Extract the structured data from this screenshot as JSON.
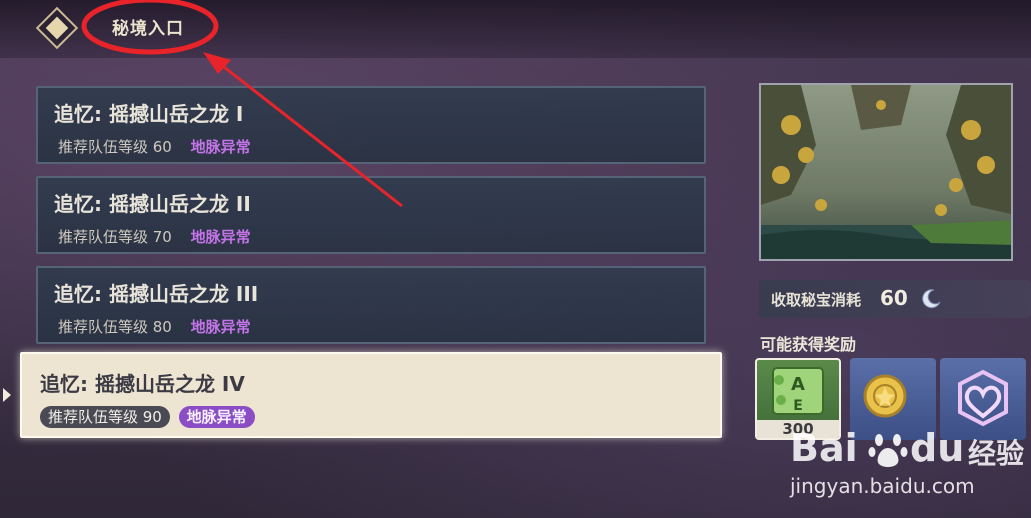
{
  "header": {
    "title": "秘境入口",
    "logo_icon": "diamond-icon"
  },
  "domains": [
    {
      "name": "追忆: 摇撼山岳之龙 I",
      "level": "推荐队伍等级 60",
      "tag": "地脉异常"
    },
    {
      "name": "追忆: 摇撼山岳之龙 II",
      "level": "推荐队伍等级 70",
      "tag": "地脉异常"
    },
    {
      "name": "追忆: 摇撼山岳之龙 III",
      "level": "推荐队伍等级 80",
      "tag": "地脉异常"
    },
    {
      "name": "追忆: 摇撼山岳之龙 IV",
      "level": "推荐队伍等级 90",
      "tag": "地脉异常",
      "selected": true
    }
  ],
  "cost": {
    "label": "收取秘宝消耗",
    "value": "60",
    "icon": "original-resin-moon-icon"
  },
  "rewards": {
    "title": "可能获得奖励",
    "items": [
      {
        "icon": "adventure-exp-icon",
        "count": "300"
      },
      {
        "icon": "mora-coin-icon",
        "count": ""
      },
      {
        "icon": "companionship-exp-icon",
        "count": ""
      }
    ]
  },
  "watermark": {
    "brand": "Bai",
    "brand2": "du",
    "cn": "经验",
    "url": "jingyan.baidu.com"
  },
  "colors": {
    "leyline": "#c274e8",
    "annotation": "#e8242a",
    "selected_bg": "#ede4d1"
  }
}
